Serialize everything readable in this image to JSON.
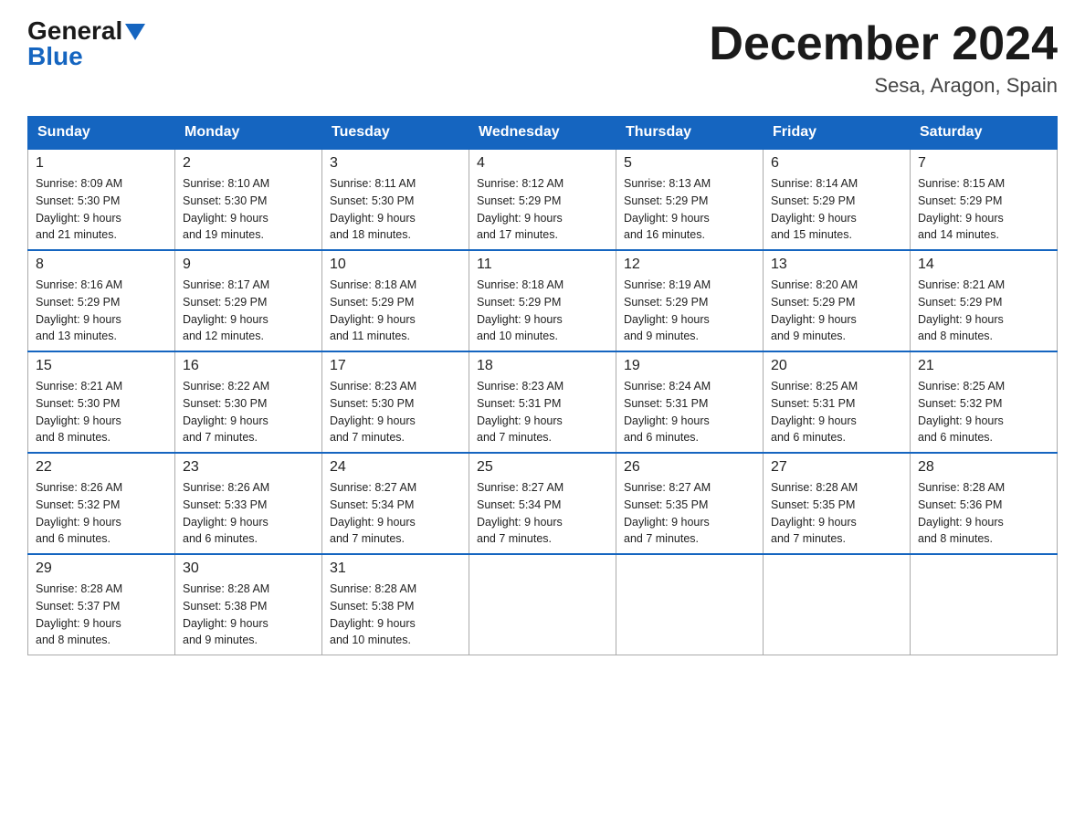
{
  "logo": {
    "general": "General",
    "blue": "Blue",
    "triangle": "▼"
  },
  "title": "December 2024",
  "subtitle": "Sesa, Aragon, Spain",
  "days_of_week": [
    "Sunday",
    "Monday",
    "Tuesday",
    "Wednesday",
    "Thursday",
    "Friday",
    "Saturday"
  ],
  "weeks": [
    [
      {
        "day": "1",
        "sunrise": "8:09 AM",
        "sunset": "5:30 PM",
        "daylight": "9 hours and 21 minutes."
      },
      {
        "day": "2",
        "sunrise": "8:10 AM",
        "sunset": "5:30 PM",
        "daylight": "9 hours and 19 minutes."
      },
      {
        "day": "3",
        "sunrise": "8:11 AM",
        "sunset": "5:30 PM",
        "daylight": "9 hours and 18 minutes."
      },
      {
        "day": "4",
        "sunrise": "8:12 AM",
        "sunset": "5:29 PM",
        "daylight": "9 hours and 17 minutes."
      },
      {
        "day": "5",
        "sunrise": "8:13 AM",
        "sunset": "5:29 PM",
        "daylight": "9 hours and 16 minutes."
      },
      {
        "day": "6",
        "sunrise": "8:14 AM",
        "sunset": "5:29 PM",
        "daylight": "9 hours and 15 minutes."
      },
      {
        "day": "7",
        "sunrise": "8:15 AM",
        "sunset": "5:29 PM",
        "daylight": "9 hours and 14 minutes."
      }
    ],
    [
      {
        "day": "8",
        "sunrise": "8:16 AM",
        "sunset": "5:29 PM",
        "daylight": "9 hours and 13 minutes."
      },
      {
        "day": "9",
        "sunrise": "8:17 AM",
        "sunset": "5:29 PM",
        "daylight": "9 hours and 12 minutes."
      },
      {
        "day": "10",
        "sunrise": "8:18 AM",
        "sunset": "5:29 PM",
        "daylight": "9 hours and 11 minutes."
      },
      {
        "day": "11",
        "sunrise": "8:18 AM",
        "sunset": "5:29 PM",
        "daylight": "9 hours and 10 minutes."
      },
      {
        "day": "12",
        "sunrise": "8:19 AM",
        "sunset": "5:29 PM",
        "daylight": "9 hours and 9 minutes."
      },
      {
        "day": "13",
        "sunrise": "8:20 AM",
        "sunset": "5:29 PM",
        "daylight": "9 hours and 9 minutes."
      },
      {
        "day": "14",
        "sunrise": "8:21 AM",
        "sunset": "5:29 PM",
        "daylight": "9 hours and 8 minutes."
      }
    ],
    [
      {
        "day": "15",
        "sunrise": "8:21 AM",
        "sunset": "5:30 PM",
        "daylight": "9 hours and 8 minutes."
      },
      {
        "day": "16",
        "sunrise": "8:22 AM",
        "sunset": "5:30 PM",
        "daylight": "9 hours and 7 minutes."
      },
      {
        "day": "17",
        "sunrise": "8:23 AM",
        "sunset": "5:30 PM",
        "daylight": "9 hours and 7 minutes."
      },
      {
        "day": "18",
        "sunrise": "8:23 AM",
        "sunset": "5:31 PM",
        "daylight": "9 hours and 7 minutes."
      },
      {
        "day": "19",
        "sunrise": "8:24 AM",
        "sunset": "5:31 PM",
        "daylight": "9 hours and 6 minutes."
      },
      {
        "day": "20",
        "sunrise": "8:25 AM",
        "sunset": "5:31 PM",
        "daylight": "9 hours and 6 minutes."
      },
      {
        "day": "21",
        "sunrise": "8:25 AM",
        "sunset": "5:32 PM",
        "daylight": "9 hours and 6 minutes."
      }
    ],
    [
      {
        "day": "22",
        "sunrise": "8:26 AM",
        "sunset": "5:32 PM",
        "daylight": "9 hours and 6 minutes."
      },
      {
        "day": "23",
        "sunrise": "8:26 AM",
        "sunset": "5:33 PM",
        "daylight": "9 hours and 6 minutes."
      },
      {
        "day": "24",
        "sunrise": "8:27 AM",
        "sunset": "5:34 PM",
        "daylight": "9 hours and 7 minutes."
      },
      {
        "day": "25",
        "sunrise": "8:27 AM",
        "sunset": "5:34 PM",
        "daylight": "9 hours and 7 minutes."
      },
      {
        "day": "26",
        "sunrise": "8:27 AM",
        "sunset": "5:35 PM",
        "daylight": "9 hours and 7 minutes."
      },
      {
        "day": "27",
        "sunrise": "8:28 AM",
        "sunset": "5:35 PM",
        "daylight": "9 hours and 7 minutes."
      },
      {
        "day": "28",
        "sunrise": "8:28 AM",
        "sunset": "5:36 PM",
        "daylight": "9 hours and 8 minutes."
      }
    ],
    [
      {
        "day": "29",
        "sunrise": "8:28 AM",
        "sunset": "5:37 PM",
        "daylight": "9 hours and 8 minutes."
      },
      {
        "day": "30",
        "sunrise": "8:28 AM",
        "sunset": "5:38 PM",
        "daylight": "9 hours and 9 minutes."
      },
      {
        "day": "31",
        "sunrise": "8:28 AM",
        "sunset": "5:38 PM",
        "daylight": "9 hours and 10 minutes."
      },
      null,
      null,
      null,
      null
    ]
  ],
  "labels": {
    "sunrise": "Sunrise:",
    "sunset": "Sunset:",
    "daylight": "Daylight:"
  }
}
